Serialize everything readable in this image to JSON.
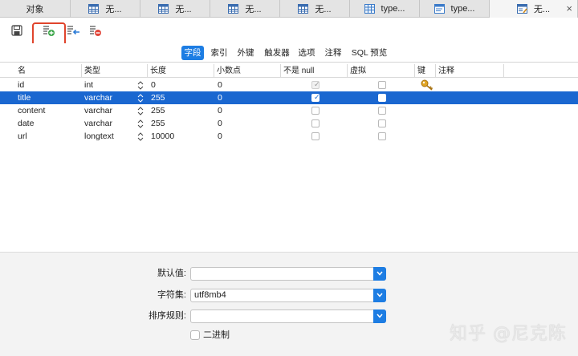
{
  "tabs": [
    {
      "label": "对象",
      "icon": "none",
      "active": false
    },
    {
      "label": "无...",
      "icon": "table-icon",
      "active": false
    },
    {
      "label": "无...",
      "icon": "table-icon",
      "active": false
    },
    {
      "label": "无...",
      "icon": "table-icon",
      "active": false
    },
    {
      "label": "无...",
      "icon": "table-icon",
      "active": false
    },
    {
      "label": "type...",
      "icon": "table-grid-icon",
      "active": false
    },
    {
      "label": "type...",
      "icon": "table-edit-icon",
      "active": false
    },
    {
      "label": "无...",
      "icon": "design-table-icon",
      "active": true
    }
  ],
  "tab_close": "×",
  "toolbar": {
    "buttons": [
      "save-icon",
      "add-field-icon",
      "insert-field-icon",
      "delete-field-icon"
    ]
  },
  "segments": [
    "字段",
    "索引",
    "外键",
    "触发器",
    "选项",
    "注释",
    "SQL 预览"
  ],
  "columns": [
    "名",
    "类型",
    "长度",
    "小数点",
    "不是 null",
    "虚拟",
    "键",
    "注释"
  ],
  "rows": [
    {
      "name": "id",
      "type": "int",
      "length": "0",
      "decimals": "0",
      "not_null": true,
      "virtual": false,
      "key": true
    },
    {
      "name": "title",
      "type": "varchar",
      "length": "255",
      "decimals": "0",
      "not_null": true,
      "virtual": false,
      "key": false
    },
    {
      "name": "content",
      "type": "varchar",
      "length": "255",
      "decimals": "0",
      "not_null": false,
      "virtual": false,
      "key": false
    },
    {
      "name": "date",
      "type": "varchar",
      "length": "255",
      "decimals": "0",
      "not_null": false,
      "virtual": false,
      "key": false
    },
    {
      "name": "url",
      "type": "longtext",
      "length": "10000",
      "decimals": "0",
      "not_null": false,
      "virtual": false,
      "key": false
    }
  ],
  "properties": {
    "default_label": "默认值:",
    "default_value": "",
    "charset_label": "字符集:",
    "charset_value": "utf8mb4",
    "collation_label": "排序规则:",
    "collation_value": "",
    "binary_label": "二进制"
  },
  "watermark": "知乎 @尼克陈",
  "colors": {
    "accent": "#1d7de3",
    "selection": "#1a67d0",
    "highlight_box": "#e0442c"
  }
}
